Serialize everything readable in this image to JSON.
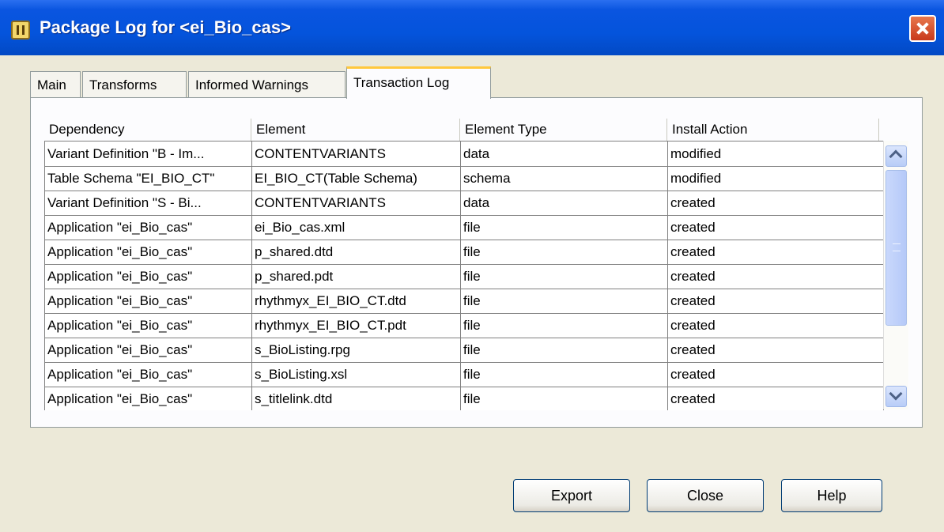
{
  "window": {
    "title": "Package Log for <ei_Bio_cas>"
  },
  "tabs": [
    {
      "label": "Main"
    },
    {
      "label": "Transforms"
    },
    {
      "label": "Informed Warnings"
    },
    {
      "label": "Transaction Log"
    }
  ],
  "table": {
    "columns": [
      "Dependency",
      "Element",
      "Element Type",
      "Install Action"
    ],
    "rows": [
      [
        "Variant Definition \"B - Im...",
        "CONTENTVARIANTS",
        "data",
        "modified"
      ],
      [
        "Table Schema \"EI_BIO_CT\"",
        "EI_BIO_CT(Table Schema)",
        "schema",
        "modified"
      ],
      [
        "Variant Definition \"S - Bi...",
        "CONTENTVARIANTS",
        "data",
        "created"
      ],
      [
        "Application \"ei_Bio_cas\"",
        "ei_Bio_cas.xml",
        "file",
        "created"
      ],
      [
        "Application \"ei_Bio_cas\"",
        "p_shared.dtd",
        "file",
        "created"
      ],
      [
        "Application \"ei_Bio_cas\"",
        "p_shared.pdt",
        "file",
        "created"
      ],
      [
        "Application \"ei_Bio_cas\"",
        "rhythmyx_EI_BIO_CT.dtd",
        "file",
        "created"
      ],
      [
        "Application \"ei_Bio_cas\"",
        "rhythmyx_EI_BIO_CT.pdt",
        "file",
        "created"
      ],
      [
        "Application \"ei_Bio_cas\"",
        "s_BioListing.rpg",
        "file",
        "created"
      ],
      [
        "Application \"ei_Bio_cas\"",
        "s_BioListing.xsl",
        "file",
        "created"
      ],
      [
        "Application \"ei_Bio_cas\"",
        "s_titlelink.dtd",
        "file",
        "created"
      ]
    ]
  },
  "buttons": {
    "export": "Export",
    "close": "Close",
    "help": "Help"
  }
}
